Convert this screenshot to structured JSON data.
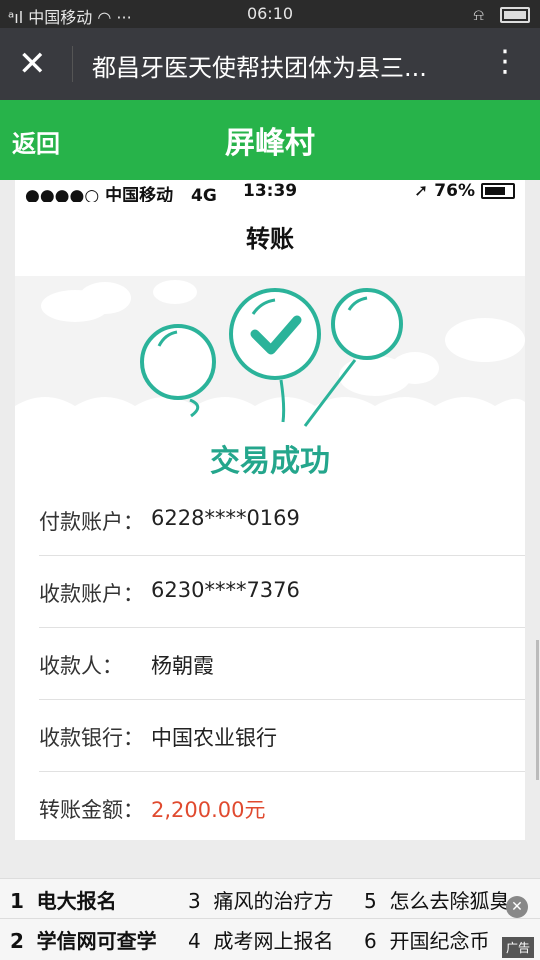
{
  "status_bar": {
    "carrier": "中国移动",
    "extra": "···",
    "time": "06:10"
  },
  "top_bar": {
    "title": "都昌牙医天使帮扶团体为县三..."
  },
  "green_bar": {
    "back_label": "返回",
    "title": "屏峰村"
  },
  "screenshot": {
    "status": {
      "signal": "●●●●○",
      "carrier": "中国移动",
      "network": "4G",
      "time": "13:39",
      "battery": "76%"
    },
    "nav_title": "转账",
    "success_text": "交易成功",
    "rows": [
      {
        "label": "付款账户：",
        "value": "6228****0169"
      },
      {
        "label": "收款账户：",
        "value": "6230****7376"
      },
      {
        "label": "收款人：",
        "value": "杨朝霞"
      },
      {
        "label": "收款银行：",
        "value": "中国农业银行"
      },
      {
        "label": "转账金额：",
        "value": "2,200.00元"
      }
    ],
    "colors": {
      "success": "#24a68c",
      "amount": "#e04a2f"
    }
  },
  "ad": {
    "row1": [
      {
        "num": "1",
        "text": "电大报名"
      },
      {
        "num": "3",
        "text": "痛风的治疗方"
      },
      {
        "num": "5",
        "text": "怎么去除狐臭"
      }
    ],
    "row2": [
      {
        "num": "2",
        "text": "学信网可查学"
      },
      {
        "num": "4",
        "text": "成考网上报名"
      },
      {
        "num": "6",
        "text": "开国纪念币"
      }
    ],
    "tag": "广告"
  },
  "colors": {
    "topbar": "#393a3f",
    "green": "#27b34a"
  }
}
